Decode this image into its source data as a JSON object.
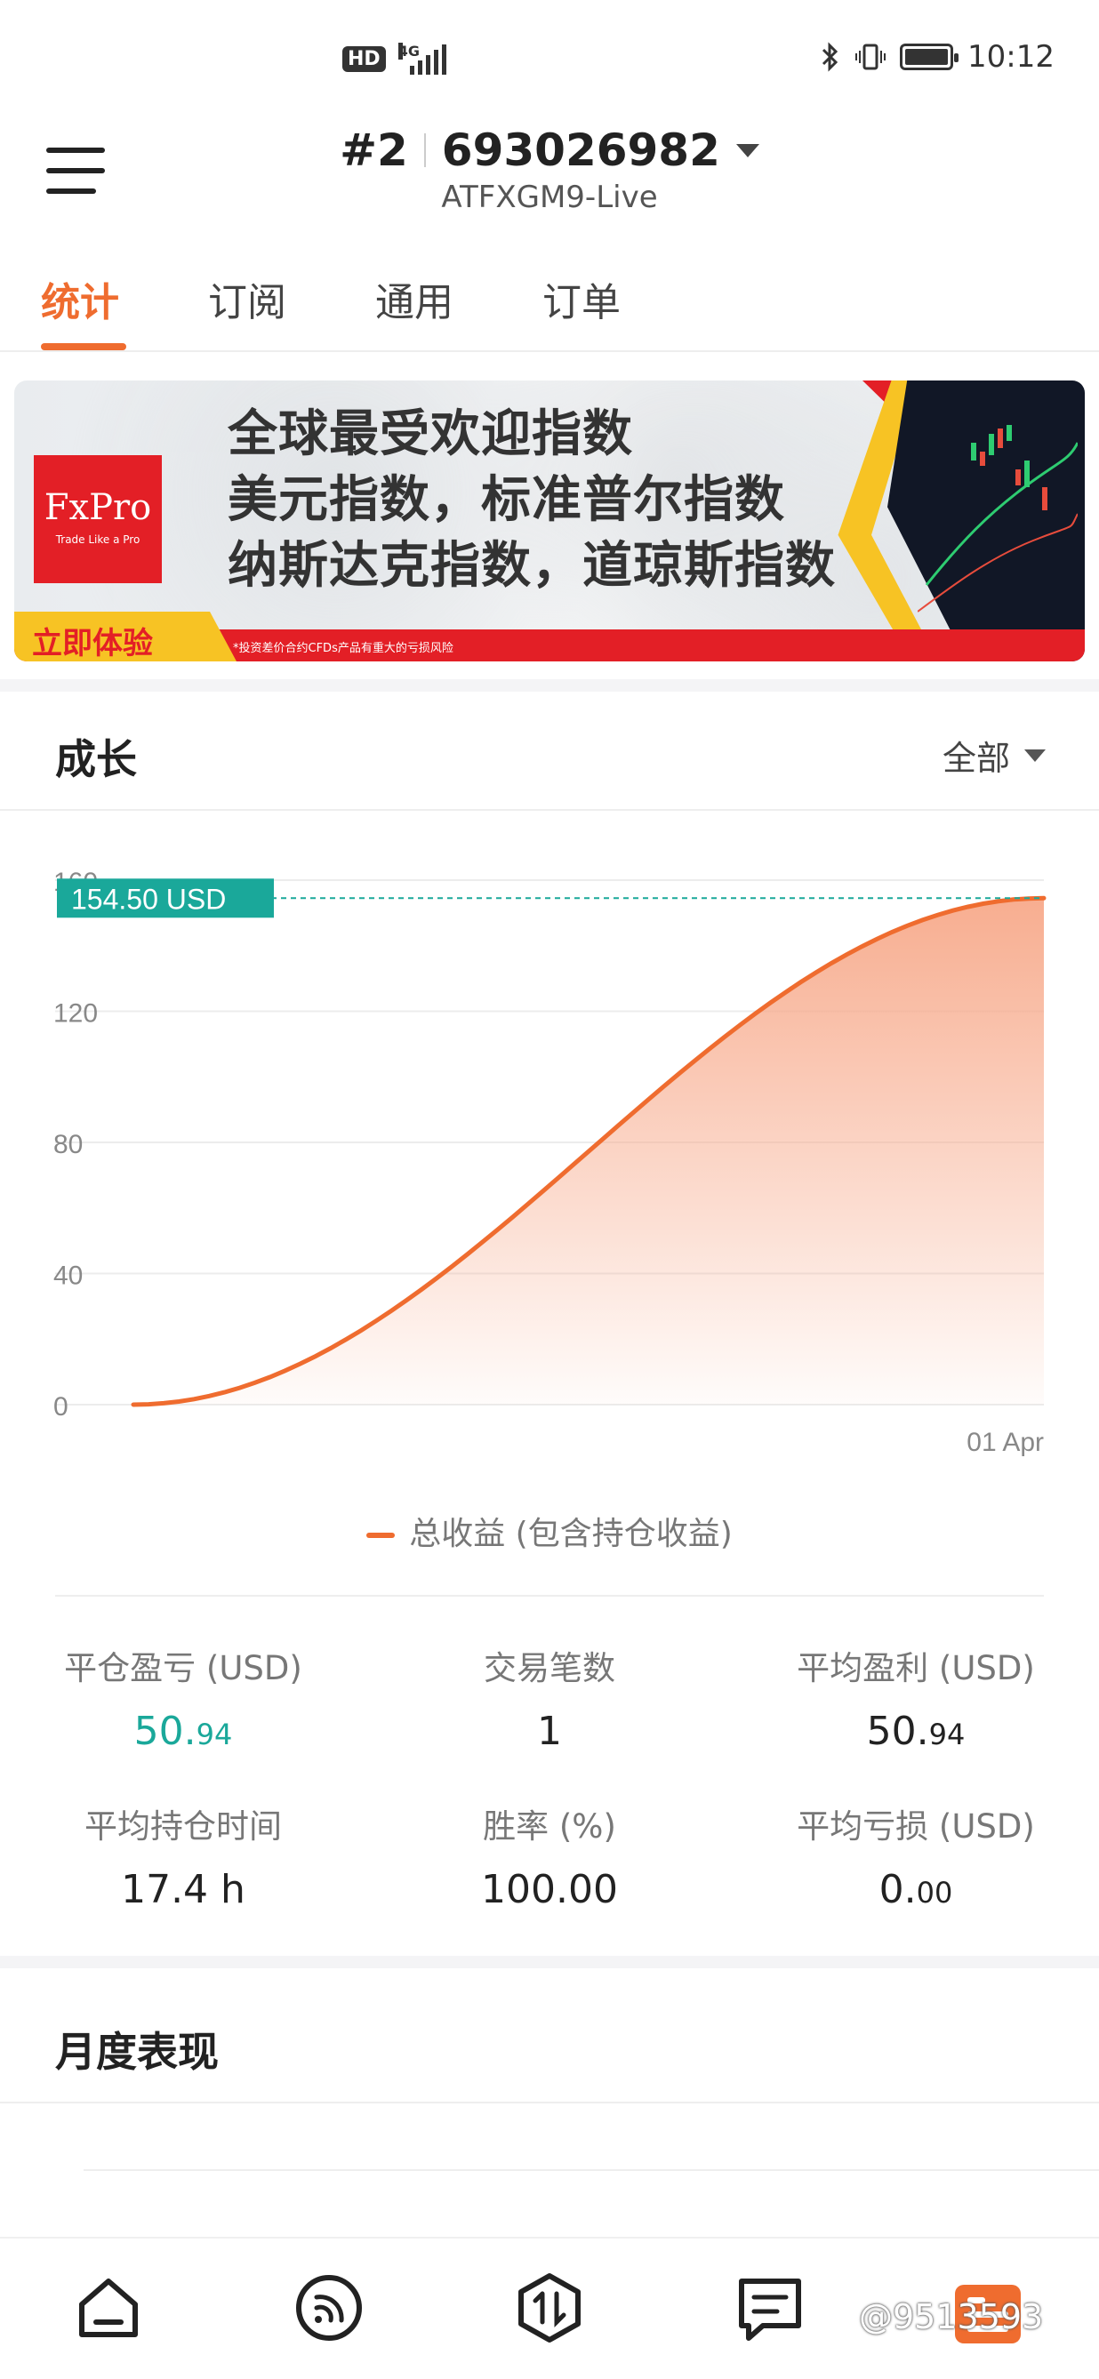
{
  "status_bar": {
    "hd": "HD",
    "network": "4G",
    "time": "10:12"
  },
  "header": {
    "account_index": "#2",
    "account_number": "693026982",
    "server": "ATFXGM9-Live"
  },
  "tabs": [
    {
      "label": "统计",
      "active": true
    },
    {
      "label": "订阅",
      "active": false
    },
    {
      "label": "通用",
      "active": false
    },
    {
      "label": "订单",
      "active": false
    }
  ],
  "banner": {
    "logo_text": "FxPro",
    "logo_tagline": "Trade Like a Pro",
    "lines": [
      "全球最受欢迎指数",
      "美元指数，标准普尔指数",
      "纳斯达克指数，道琼斯指数"
    ],
    "cta": "立即体验",
    "disclaimer": "*投资差价合约CFDs产品有重大的亏损风险"
  },
  "growth": {
    "title": "成长",
    "filter": "全部",
    "current_label": "154.50 USD",
    "legend": "总收益 (包含持仓收益)"
  },
  "chart_data": {
    "type": "area",
    "x": [
      "",
      "01 Apr"
    ],
    "y_ticks": [
      0,
      40,
      80,
      120,
      160
    ],
    "ylim": [
      0,
      160
    ],
    "series": [
      {
        "name": "总收益 (包含持仓收益)",
        "values": [
          0,
          154.5
        ],
        "shape": "s-curve"
      }
    ],
    "current_value": 154.5,
    "current_value_label": "154.50 USD",
    "colors": {
      "line": "#ef6c2f",
      "fill": "#f7a98a",
      "marker": "#1aa89a"
    }
  },
  "stats": {
    "closed_pl": {
      "label": "平仓盈亏 (USD)",
      "int": "50.",
      "dec": "94"
    },
    "trades": {
      "label": "交易笔数",
      "value": "1"
    },
    "avg_profit": {
      "label": "平均盈利 (USD)",
      "int": "50.",
      "dec": "94"
    },
    "avg_hold": {
      "label": "平均持仓时间",
      "value": "17.4 h"
    },
    "win_rate": {
      "label": "胜率 (%)",
      "value": "100.00"
    },
    "avg_loss": {
      "label": "平均亏损 (USD)",
      "int": "0.",
      "dec": "00"
    }
  },
  "monthly": {
    "title": "月度表现"
  },
  "bottom_nav": {
    "items": [
      "home-icon",
      "signal-icon",
      "trade-icon",
      "chat-icon",
      "profile-icon"
    ],
    "watermark": "@9513593"
  },
  "colors": {
    "accent": "#ef6c2f",
    "positive": "#1aa89a"
  }
}
